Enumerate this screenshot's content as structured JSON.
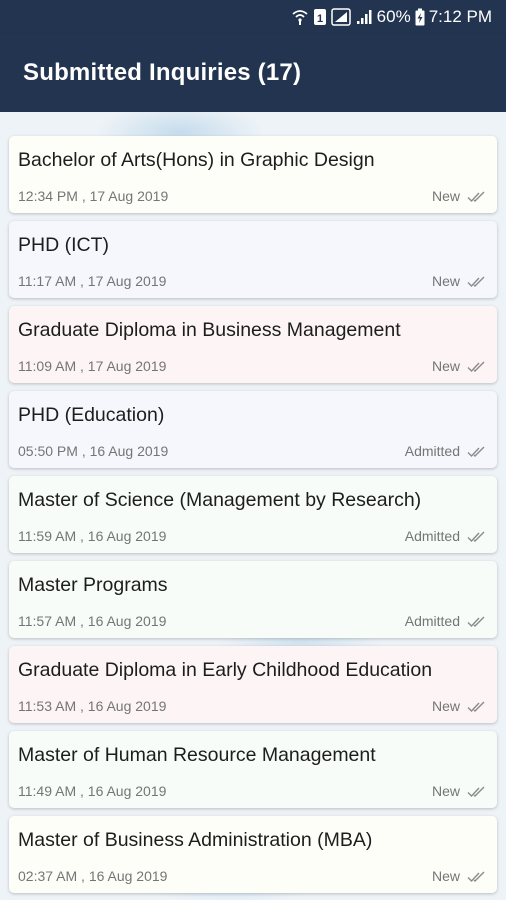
{
  "status_bar": {
    "battery": "60%",
    "time": "7:12 PM",
    "sim_label": "1"
  },
  "app_bar": {
    "title": "Submitted Inquiries (17)"
  },
  "colors": {
    "app_bar": "#22344f",
    "card_yellow": "#fefef8",
    "card_lavender": "#f6f6fd",
    "card_pink": "#fdf5f5",
    "card_mint": "#f7fcf8"
  },
  "inquiries": [
    {
      "title": "Bachelor of Arts(Hons) in Graphic Design",
      "datetime": "12:34 PM , 17 Aug 2019",
      "status": "New",
      "tint": "#fefef8"
    },
    {
      "title": "PHD (ICT)",
      "datetime": "11:17 AM , 17 Aug 2019",
      "status": "New",
      "tint": "#f6f6fd"
    },
    {
      "title": "Graduate Diploma in Business Management",
      "datetime": "11:09 AM , 17 Aug 2019",
      "status": "New",
      "tint": "#fdf5f5"
    },
    {
      "title": "PHD (Education)",
      "datetime": "05:50 PM , 16 Aug 2019",
      "status": "Admitted",
      "tint": "#f6f6fd"
    },
    {
      "title": "Master of Science (Management by Research)",
      "datetime": "11:59 AM , 16 Aug 2019",
      "status": "Admitted",
      "tint": "#f7fcf8"
    },
    {
      "title": "Master Programs",
      "datetime": "11:57 AM , 16 Aug 2019",
      "status": "Admitted",
      "tint": "#f7fcf8"
    },
    {
      "title": "Graduate Diploma in Early Childhood Education",
      "datetime": "11:53 AM , 16 Aug 2019",
      "status": "New",
      "tint": "#fdf5f5"
    },
    {
      "title": "Master of Human Resource Management",
      "datetime": "11:49 AM , 16 Aug 2019",
      "status": "New",
      "tint": "#f7fcf8"
    },
    {
      "title": "Master of Business Administration (MBA)",
      "datetime": "02:37 AM , 16 Aug 2019",
      "status": "New",
      "tint": "#fefef8"
    }
  ]
}
